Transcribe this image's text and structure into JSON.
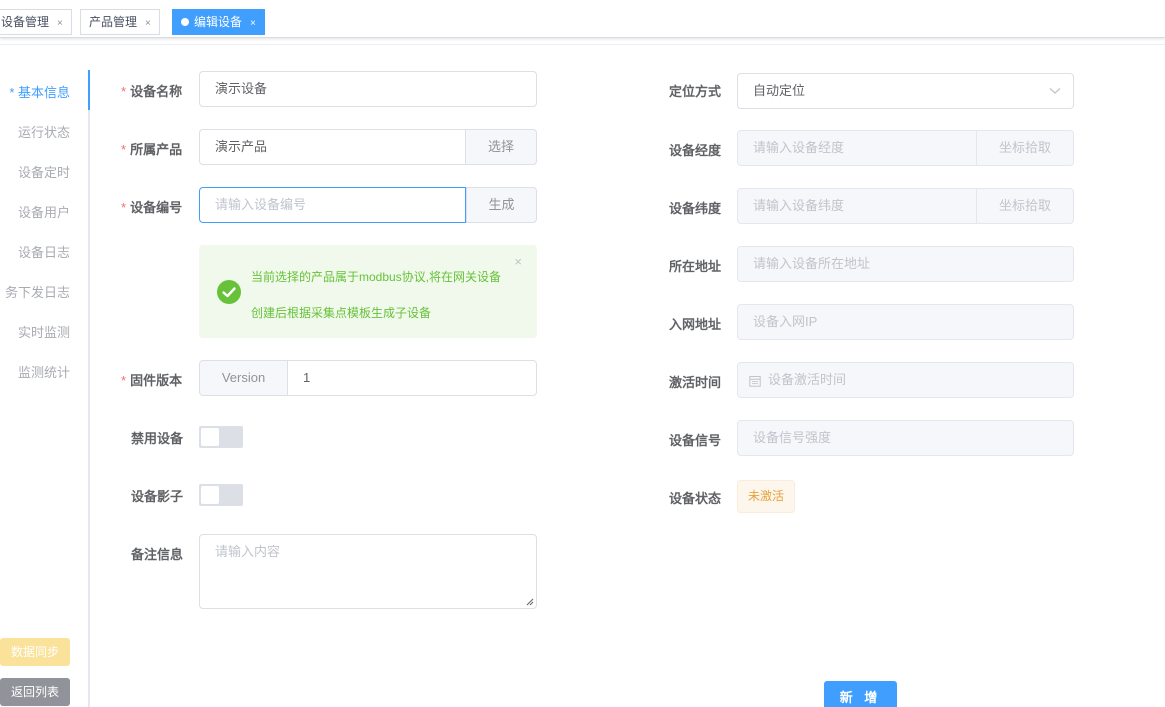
{
  "tabs": [
    {
      "label": "设备管理",
      "close": "×"
    },
    {
      "label": "产品管理",
      "close": "×"
    },
    {
      "label": "编辑设备",
      "close": "×"
    }
  ],
  "sidenav": {
    "items": [
      "* 基本信息",
      "运行状态",
      "设备定时",
      "设备用户",
      "设备日志",
      "务下发日志",
      "实时监测",
      "监测统计"
    ],
    "sync_label": "数据同步",
    "back_label": "返回列表"
  },
  "form": {
    "device_name": {
      "label": "设备名称",
      "value": "演示设备"
    },
    "product": {
      "label": "所属产品",
      "value": "演示产品",
      "button": "选择"
    },
    "serial": {
      "label": "设备编号",
      "placeholder": "请输入设备编号",
      "button": "生成"
    },
    "alert": {
      "line1": "当前选择的产品属于modbus协议,将在网关设备",
      "line2": "创建后根据采集点模板生成子设备",
      "close": "×"
    },
    "firmware": {
      "label": "固件版本",
      "prefix": "Version",
      "value": "1"
    },
    "disable": {
      "label": "禁用设备"
    },
    "shadow": {
      "label": "设备影子"
    },
    "remark": {
      "label": "备注信息",
      "placeholder": "请输入内容"
    },
    "locate_mode": {
      "label": "定位方式",
      "value": "自动定位"
    },
    "longitude": {
      "label": "设备经度",
      "placeholder": "请输入设备经度",
      "button": "坐标拾取"
    },
    "latitude": {
      "label": "设备纬度",
      "placeholder": "请输入设备纬度",
      "button": "坐标拾取"
    },
    "address": {
      "label": "所在地址",
      "placeholder": "请输入设备所在地址"
    },
    "network_address": {
      "label": "入网地址",
      "placeholder": "设备入网IP"
    },
    "activation_time": {
      "label": "激活时间",
      "placeholder": "设备激活时间"
    },
    "signal": {
      "label": "设备信号",
      "placeholder": "设备信号强度"
    },
    "status": {
      "label": "设备状态",
      "value": "未激活"
    },
    "submit_label": "新 增"
  },
  "colors": {
    "primary": "#409eff",
    "success": "#67c23a",
    "warning": "#e6a23c",
    "danger": "#f56c6c"
  },
  "icons": [
    "close-icon",
    "success-check-icon",
    "chevron-down-icon",
    "calendar-icon"
  ]
}
